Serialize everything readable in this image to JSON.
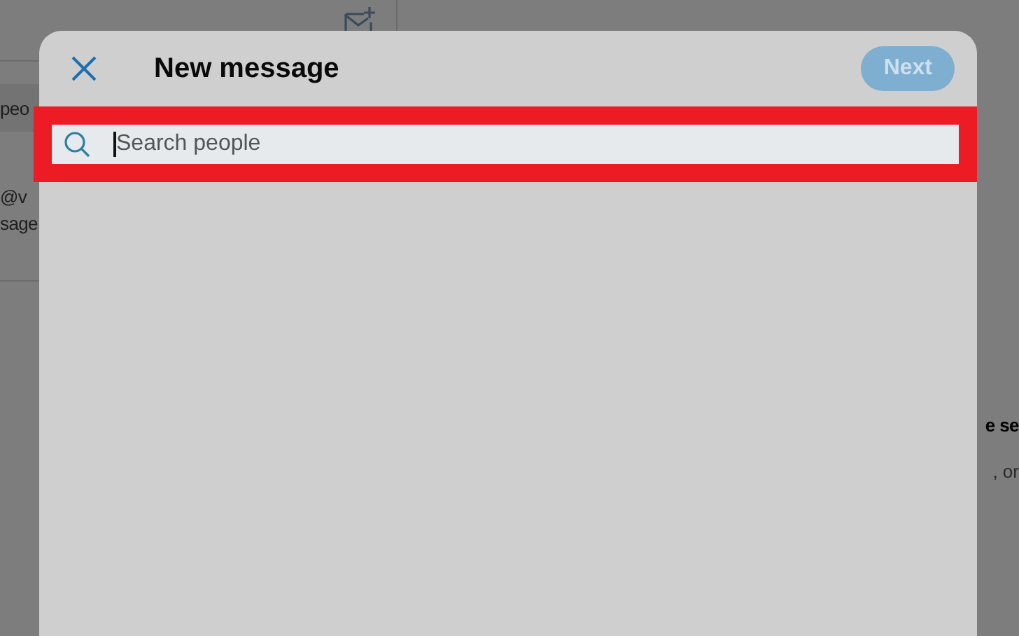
{
  "background": {
    "left_fragments": [
      {
        "kind": "field",
        "text": "peo"
      },
      {
        "kind": "handle",
        "text": "@v"
      },
      {
        "kind": "snippet",
        "text": "sage"
      }
    ],
    "right_fragments": [
      {
        "kind": "heading",
        "text": "e se"
      },
      {
        "kind": "body",
        "text": ", or"
      }
    ]
  },
  "dialog": {
    "title": "New message",
    "next_button": {
      "label": "Next",
      "disabled": true
    },
    "search": {
      "placeholder": "Search people",
      "focused": true,
      "highlighted": true
    }
  }
}
